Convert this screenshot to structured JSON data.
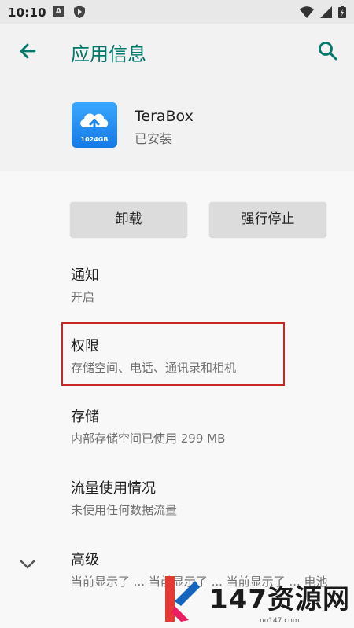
{
  "status_bar": {
    "time": "10:10",
    "notif_icon_a": "A"
  },
  "app_bar": {
    "title": "应用信息",
    "back_icon": "arrow-left-icon",
    "search_icon": "search-icon"
  },
  "app": {
    "name": "TeraBox",
    "status": "已安装",
    "icon_caption": "1024GB"
  },
  "buttons": {
    "uninstall": "卸载",
    "force_stop": "强行停止"
  },
  "items": [
    {
      "title": "通知",
      "subtitle": "开启"
    },
    {
      "title": "权限",
      "subtitle": "存储空间、电话、通讯录和相机"
    },
    {
      "title": "存储",
      "subtitle": "内部存储空间已使用 299 MB"
    },
    {
      "title": "流量使用情况",
      "subtitle": "未使用任何数据流量"
    },
    {
      "title": "高级",
      "subtitle": "当前显示了 ... 当前显示了 ... 当前显示了 ... 电池"
    }
  ],
  "watermark": {
    "brand": "147资源网",
    "url": "no147.com"
  },
  "colors": {
    "accent": "#00796b",
    "highlight": "#c62828"
  }
}
